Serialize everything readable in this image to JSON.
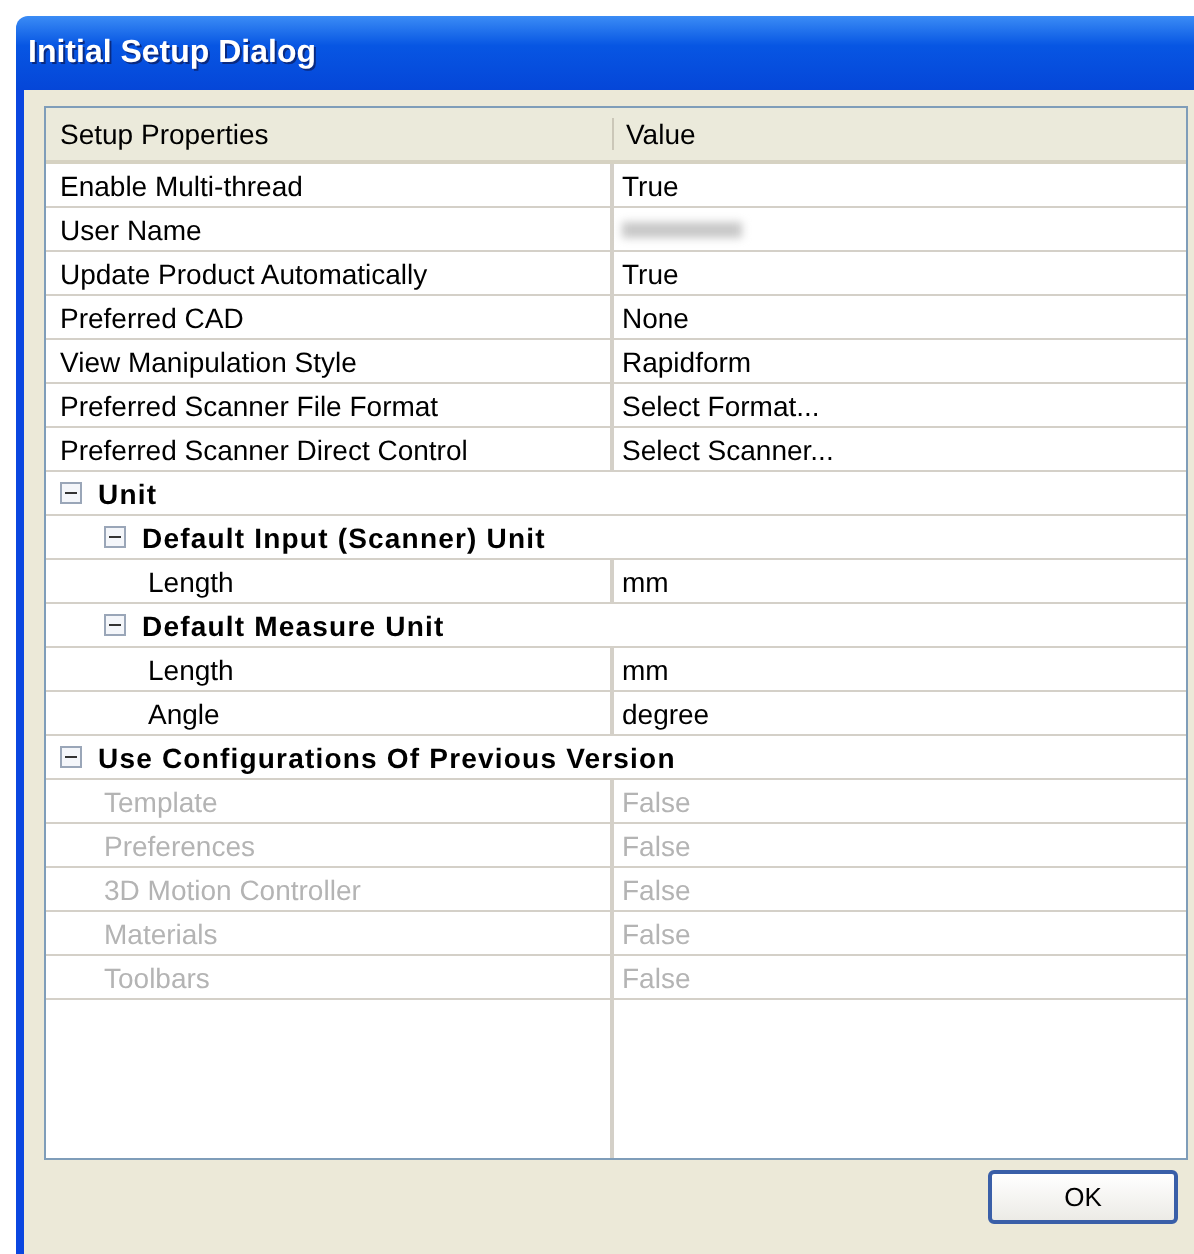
{
  "window": {
    "title": "Initial Setup Dialog"
  },
  "table": {
    "columns": [
      "Setup Properties",
      "Value"
    ],
    "rows": [
      {
        "name": "Enable Multi-thread",
        "value": "True"
      },
      {
        "name": "User Name",
        "redacted": true
      },
      {
        "name": "Update Product Automatically",
        "value": "True"
      },
      {
        "name": "Preferred CAD",
        "value": "None"
      },
      {
        "name": "View Manipulation Style",
        "value": "Rapidform"
      },
      {
        "name": "Preferred Scanner File Format",
        "value": "Select Format..."
      },
      {
        "name": "Preferred Scanner Direct Control",
        "value": "Select Scanner..."
      },
      {
        "name": "Unit",
        "expanded": true,
        "children": [
          {
            "name": "Default Input (Scanner) Unit",
            "expanded": true,
            "children": [
              {
                "name": "Length",
                "value": "mm"
              }
            ]
          },
          {
            "name": "Default Measure Unit",
            "expanded": true,
            "children": [
              {
                "name": "Length",
                "value": "mm"
              },
              {
                "name": "Angle",
                "value": "degree"
              }
            ]
          }
        ]
      },
      {
        "name": "Use Configurations Of Previous Version",
        "expanded": true,
        "children": [
          {
            "name": "Template",
            "value": "False",
            "disabled": true
          },
          {
            "name": "Preferences",
            "value": "False",
            "disabled": true
          },
          {
            "name": "3D Motion Controller",
            "value": "False",
            "disabled": true
          },
          {
            "name": "Materials",
            "value": "False",
            "disabled": true
          },
          {
            "name": "Toolbars",
            "value": "False",
            "disabled": true
          }
        ]
      }
    ]
  },
  "buttons": [
    "OK"
  ]
}
